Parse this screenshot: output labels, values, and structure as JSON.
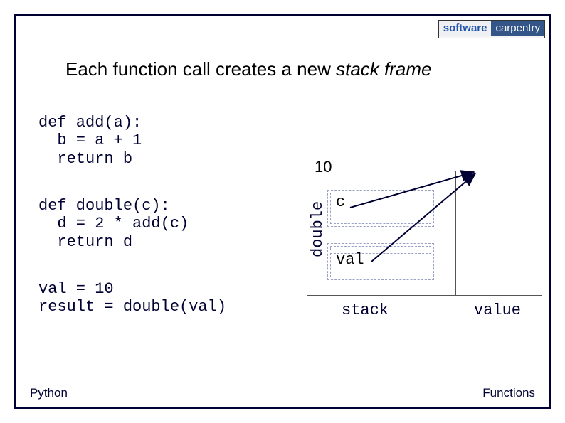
{
  "logo": {
    "left": "software",
    "right": "carpentry",
    "sub": ""
  },
  "title": {
    "pre": "Each function call creates a new ",
    "emph": "stack frame"
  },
  "code": {
    "block1": "def add(a):\n  b = a + 1\n  return b",
    "block2": "def double(c):\n  d = 2 * add(c)\n  return d",
    "block3": "val = 10\nresult = double(val)"
  },
  "diagram": {
    "vertical_label": "double",
    "box_c_label": "c",
    "box_val_label": "val",
    "value_10": "10",
    "stack_label": "stack",
    "value_label": "value"
  },
  "footer": {
    "left": "Python",
    "right": "Functions"
  }
}
